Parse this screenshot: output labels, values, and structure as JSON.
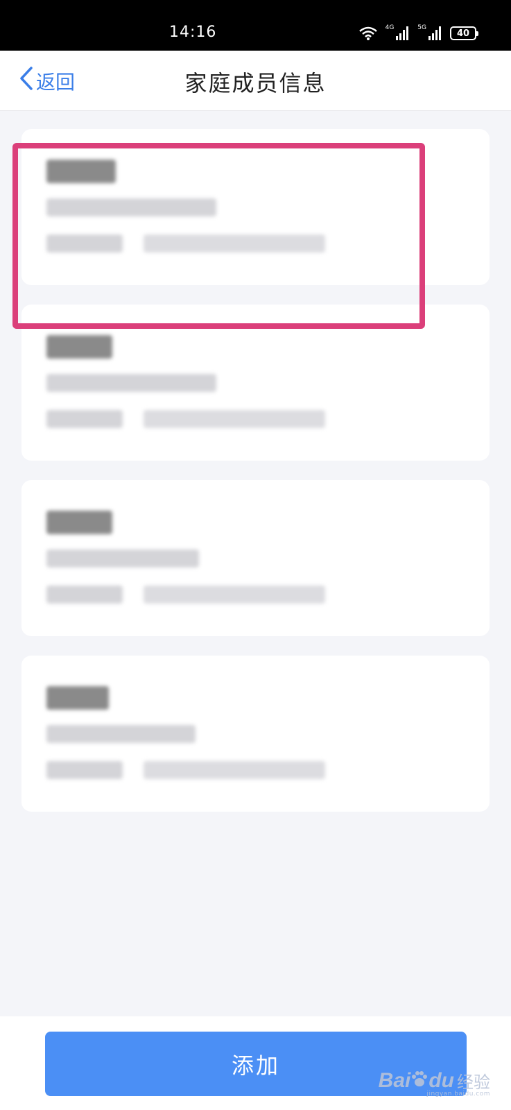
{
  "status_bar": {
    "time": "14:16",
    "network_1": "4G",
    "network_2": "5G",
    "battery": "40"
  },
  "nav": {
    "back_label": "返回",
    "title": "家庭成员信息"
  },
  "members": [
    {
      "name": "",
      "detail": "",
      "id_label": "",
      "id_value": ""
    },
    {
      "name": "",
      "detail": "",
      "id_label": "",
      "id_value": ""
    },
    {
      "name": "",
      "detail": "",
      "id_label": "",
      "id_value": ""
    },
    {
      "name": "",
      "detail": "",
      "id_label": "",
      "id_value": ""
    }
  ],
  "footer": {
    "add_label": "添加"
  },
  "watermark": {
    "brand_1": "Bai",
    "brand_2": "du",
    "brand_3": "经验",
    "url": "jingyan.baidu.com"
  },
  "colors": {
    "accent": "#4b8ff5",
    "highlight": "#db3f7a",
    "background": "#f4f5f9"
  }
}
